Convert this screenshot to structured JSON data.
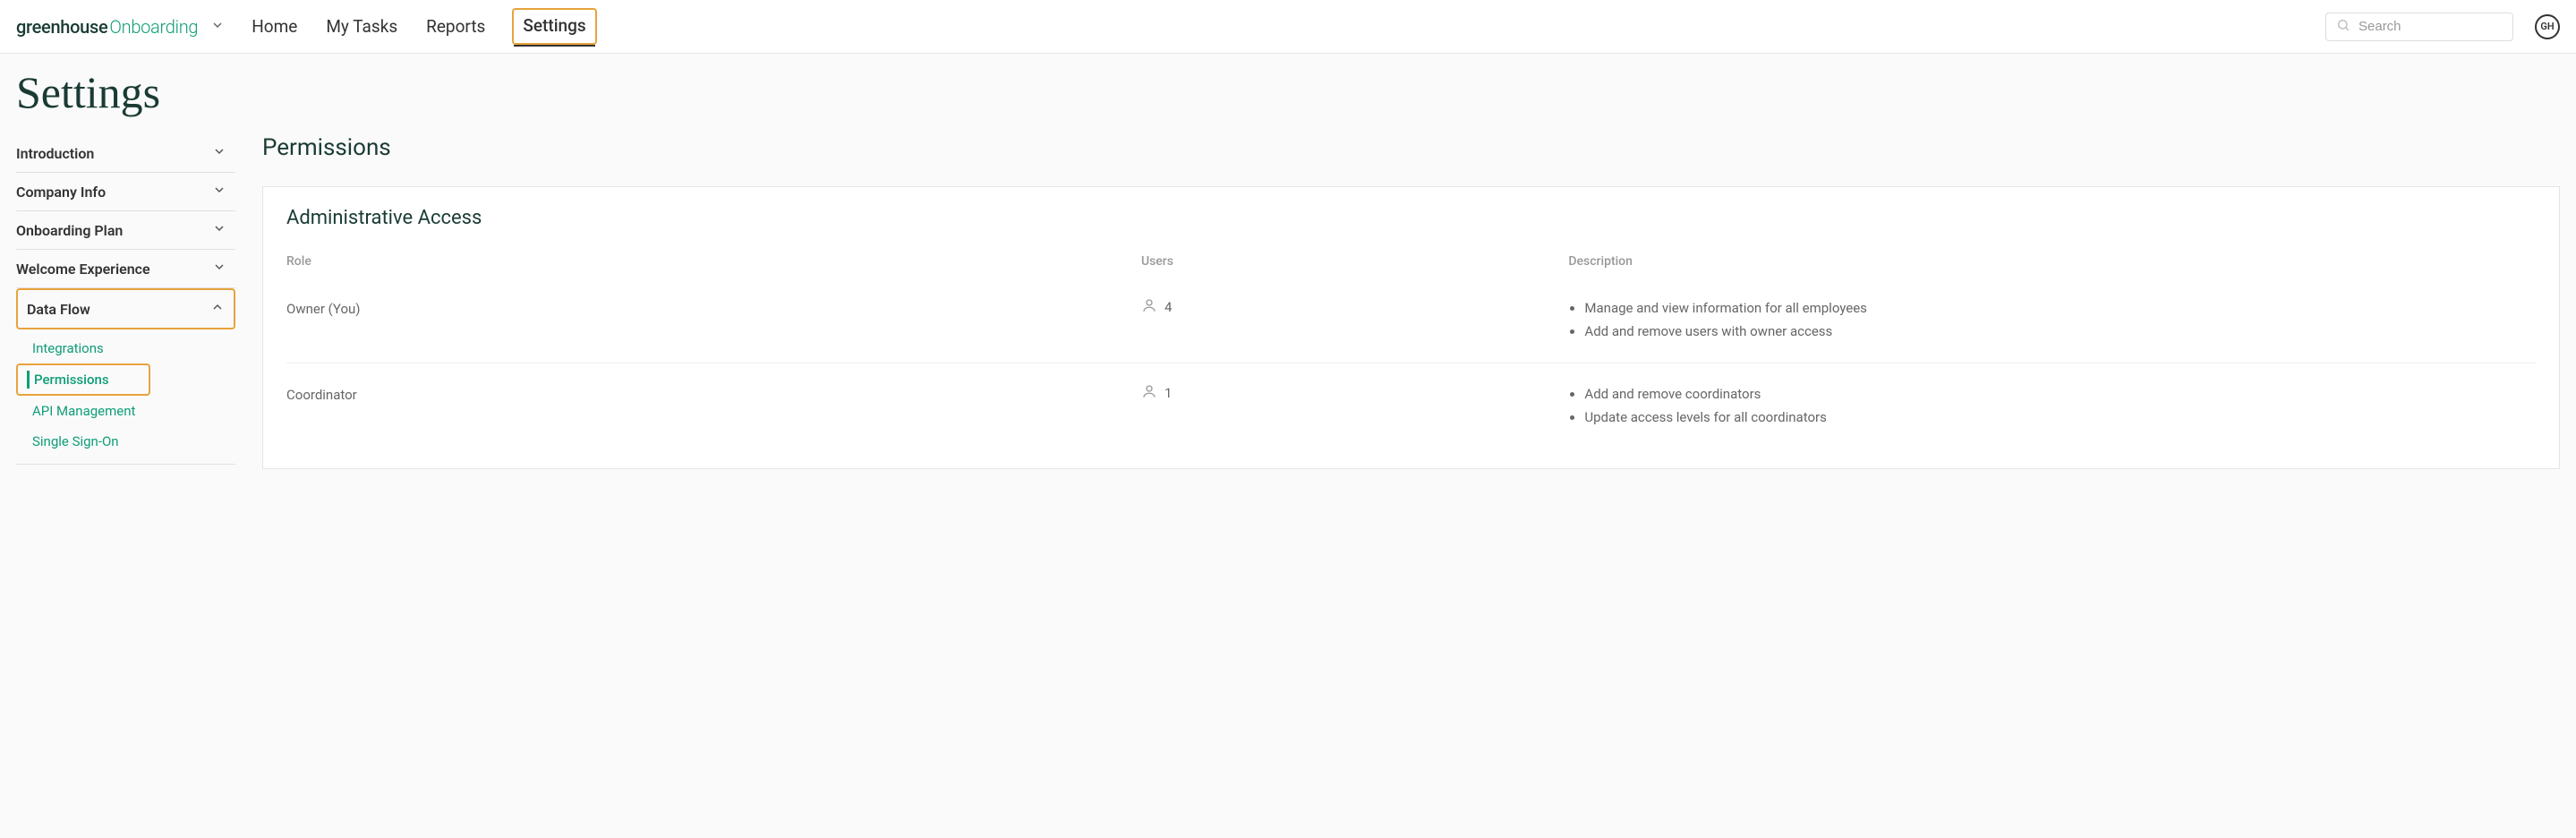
{
  "brand": {
    "greenhouse": "greenhouse",
    "onboarding": "Onboarding"
  },
  "nav": {
    "home": "Home",
    "my_tasks": "My Tasks",
    "reports": "Reports",
    "settings": "Settings"
  },
  "search": {
    "placeholder": "Search"
  },
  "avatar": {
    "initials": "GH"
  },
  "page_title": "Settings",
  "sidebar": {
    "items": [
      {
        "label": "Introduction",
        "expanded": false
      },
      {
        "label": "Company Info",
        "expanded": false
      },
      {
        "label": "Onboarding Plan",
        "expanded": false
      },
      {
        "label": "Welcome Experience",
        "expanded": false
      },
      {
        "label": "Data Flow",
        "expanded": true
      }
    ],
    "sub": {
      "integrations": "Integrations",
      "permissions": "Permissions",
      "api_management": "API Management",
      "sso": "Single Sign-On"
    }
  },
  "main": {
    "section_title": "Permissions",
    "card_title": "Administrative Access",
    "columns": {
      "role": "Role",
      "users": "Users",
      "description": "Description"
    },
    "rows": [
      {
        "role": "Owner (You)",
        "users": "4",
        "desc": [
          "Manage and view information for all employees",
          "Add and remove users with owner access"
        ]
      },
      {
        "role": "Coordinator",
        "users": "1",
        "desc": [
          "Add and remove coordinators",
          "Update access levels for all coordinators"
        ]
      }
    ]
  }
}
